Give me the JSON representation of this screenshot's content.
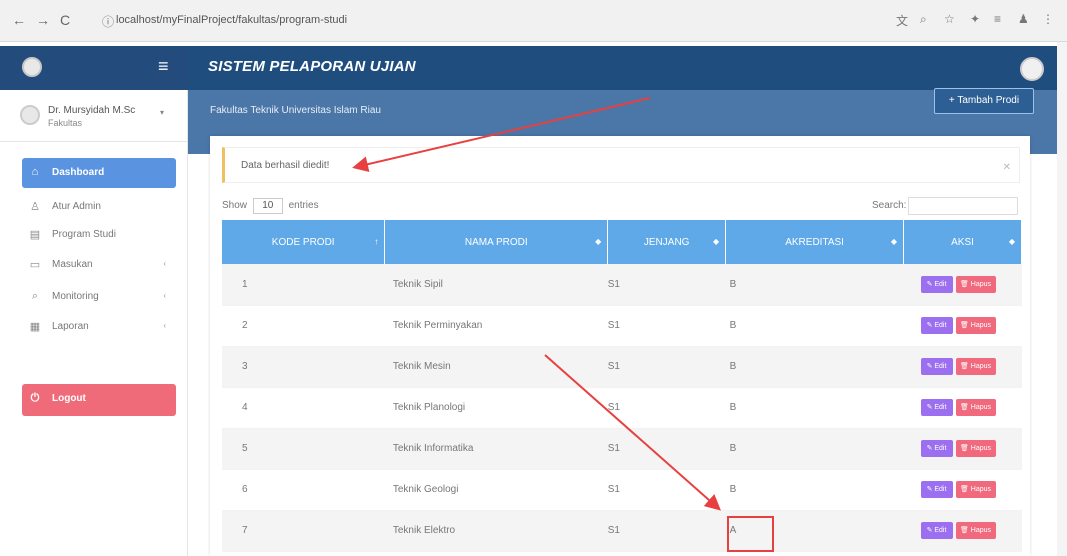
{
  "browser": {
    "url": "localhost/myFinalProject/fakultas/program-studi",
    "back_icon": "arrow-left-icon",
    "forward_icon": "arrow-right-icon",
    "reload_icon": "reload-icon"
  },
  "header": {
    "title": "SISTEM PELAPORAN UJIAN",
    "menu_icon": "hamburger-icon"
  },
  "user": {
    "name": "Dr. Mursyidah M.Sc",
    "role": "Fakultas"
  },
  "sidebar": {
    "items": [
      {
        "label": "Dashboard",
        "icon": "home-icon",
        "active": true
      },
      {
        "label": "Atur Admin",
        "icon": "user-icon"
      },
      {
        "label": "Program Studi",
        "icon": "book-icon"
      },
      {
        "label": "Masukan",
        "icon": "inbox-icon",
        "caret": "‹"
      },
      {
        "label": "Monitoring",
        "icon": "search-icon",
        "caret": "‹"
      },
      {
        "label": "Laporan",
        "icon": "table-icon",
        "caret": "‹"
      }
    ],
    "logout_label": "Logout"
  },
  "content": {
    "breadcrumb": "Fakultas Teknik Universitas Islam Riau",
    "add_button": "+ Tambah Prodi",
    "alert": "Data berhasil diedit!",
    "show_label": "Show",
    "show_value": "10",
    "entries_label": "entries",
    "search_label": "Search:"
  },
  "table": {
    "columns": [
      "KODE PRODI",
      "NAMA PRODI",
      "JENJANG",
      "AKREDITASI",
      "AKSI"
    ],
    "edit_label": "✎ Edit",
    "delete_label": "🗑 Hapus",
    "rows": [
      {
        "kode": "1",
        "nama": "Teknik Sipil",
        "jenjang": "S1",
        "akreditasi": "B"
      },
      {
        "kode": "2",
        "nama": "Teknik Perminyakan",
        "jenjang": "S1",
        "akreditasi": "B"
      },
      {
        "kode": "3",
        "nama": "Teknik Mesin",
        "jenjang": "S1",
        "akreditasi": "B"
      },
      {
        "kode": "4",
        "nama": "Teknik Planologi",
        "jenjang": "S1",
        "akreditasi": "B"
      },
      {
        "kode": "5",
        "nama": "Teknik Informatika",
        "jenjang": "S1",
        "akreditasi": "B"
      },
      {
        "kode": "6",
        "nama": "Teknik Geologi",
        "jenjang": "S1",
        "akreditasi": "B"
      },
      {
        "kode": "7",
        "nama": "Teknik Elektro",
        "jenjang": "S1",
        "akreditasi": "A"
      }
    ]
  },
  "colors": {
    "header": "#1f4e7e",
    "active_menu": "#5a93e0",
    "logout": "#f06b7a",
    "table_header": "#5fa9e8",
    "annotation": "#e84040"
  }
}
